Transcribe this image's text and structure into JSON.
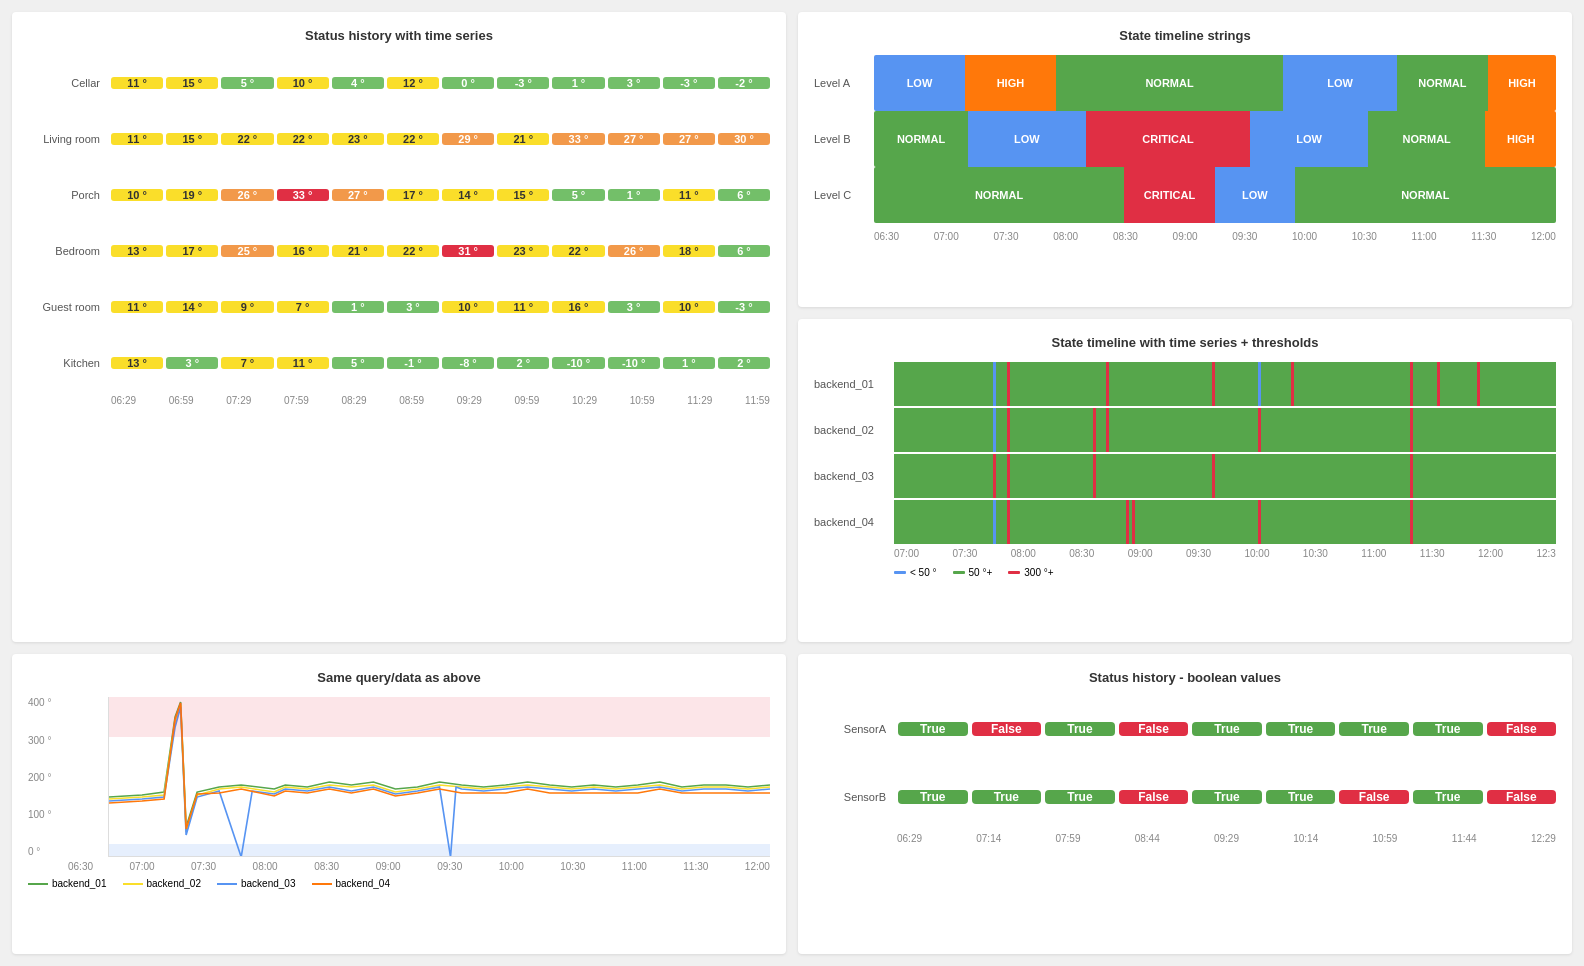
{
  "panels": {
    "state_timeline_strings": {
      "title": "State timeline strings",
      "rows": [
        {
          "label": "Level A",
          "segments": [
            {
              "type": "low",
              "label": "LOW",
              "flex": 8
            },
            {
              "type": "high",
              "label": "HIGH",
              "flex": 8
            },
            {
              "type": "normal",
              "label": "NORMAL",
              "flex": 20
            },
            {
              "type": "low",
              "label": "LOW",
              "flex": 10
            },
            {
              "type": "normal",
              "label": "NORMAL",
              "flex": 8
            },
            {
              "type": "high",
              "label": "HIGH",
              "flex": 6
            }
          ]
        },
        {
          "label": "Level B",
          "segments": [
            {
              "type": "normal",
              "label": "NORMAL",
              "flex": 8
            },
            {
              "type": "low",
              "label": "LOW",
              "flex": 10
            },
            {
              "type": "critical",
              "label": "CRITICAL",
              "flex": 14
            },
            {
              "type": "low",
              "label": "LOW",
              "flex": 10
            },
            {
              "type": "normal",
              "label": "NORMAL",
              "flex": 10
            },
            {
              "type": "high",
              "label": "HIGH",
              "flex": 6
            }
          ]
        },
        {
          "label": "Level C",
          "segments": [
            {
              "type": "normal",
              "label": "NORMAL",
              "flex": 22
            },
            {
              "type": "critical",
              "label": "CRITICAL",
              "flex": 8
            },
            {
              "type": "low",
              "label": "LOW",
              "flex": 7
            },
            {
              "type": "normal",
              "label": "NORMAL",
              "flex": 23
            }
          ]
        }
      ],
      "xaxis": [
        "06:30",
        "07:00",
        "07:30",
        "08:00",
        "08:30",
        "09:00",
        "09:30",
        "10:00",
        "10:30",
        "11:00",
        "11:30",
        "12:00"
      ]
    },
    "state_timeline_thresholds": {
      "title": "State timeline with time series + thresholds",
      "backends": [
        "backend_01",
        "backend_02",
        "backend_03",
        "backend_04"
      ],
      "xaxis": [
        "07:00",
        "07:30",
        "08:00",
        "08:30",
        "09:00",
        "09:30",
        "10:00",
        "10:30",
        "11:00",
        "11:30",
        "12:00",
        "12:3"
      ],
      "legend": [
        {
          "color": "#5794F2",
          "label": "< 50 °"
        },
        {
          "color": "#56A64B",
          "label": "50 °+"
        },
        {
          "color": "#E02F44",
          "label": "300 °+"
        }
      ],
      "thresholds": {
        "backend_01": [
          {
            "pos": 15,
            "type": "blue"
          },
          {
            "pos": 17,
            "type": "red"
          },
          {
            "pos": 32,
            "type": "red"
          },
          {
            "pos": 48,
            "type": "red"
          },
          {
            "pos": 55,
            "type": "blue"
          },
          {
            "pos": 60,
            "type": "red"
          },
          {
            "pos": 78,
            "type": "red"
          },
          {
            "pos": 82,
            "type": "red"
          },
          {
            "pos": 88,
            "type": "red"
          }
        ],
        "backend_02": [
          {
            "pos": 15,
            "type": "blue"
          },
          {
            "pos": 17,
            "type": "red"
          },
          {
            "pos": 30,
            "type": "red"
          },
          {
            "pos": 32,
            "type": "red"
          },
          {
            "pos": 55,
            "type": "red"
          },
          {
            "pos": 78,
            "type": "red"
          }
        ],
        "backend_03": [
          {
            "pos": 15,
            "type": "red"
          },
          {
            "pos": 17,
            "type": "red"
          },
          {
            "pos": 30,
            "type": "red"
          },
          {
            "pos": 48,
            "type": "red"
          },
          {
            "pos": 78,
            "type": "red"
          }
        ],
        "backend_04": [
          {
            "pos": 15,
            "type": "blue"
          },
          {
            "pos": 17,
            "type": "red"
          },
          {
            "pos": 35,
            "type": "red"
          },
          {
            "pos": 36,
            "type": "red"
          },
          {
            "pos": 55,
            "type": "red"
          },
          {
            "pos": 78,
            "type": "red"
          }
        ]
      }
    },
    "same_query": {
      "title": "Same query/data as above",
      "xaxis": [
        "06:30",
        "07:00",
        "07:30",
        "08:00",
        "08:30",
        "09:00",
        "09:30",
        "10:00",
        "10:30",
        "11:00",
        "11:30",
        "12:00"
      ],
      "yaxis": [
        "0 °",
        "100 °",
        "200 °",
        "300 °",
        "400 °"
      ],
      "legend": [
        {
          "color": "#56A64B",
          "label": "backend_01"
        },
        {
          "color": "#FADE2A",
          "label": "backend_02"
        },
        {
          "color": "#5794F2",
          "label": "backend_03"
        },
        {
          "color": "#FF780A",
          "label": "backend_04"
        }
      ]
    },
    "status_history": {
      "title": "Status history with time series",
      "rows": [
        {
          "label": "Cellar",
          "cells": [
            {
              "value": "11 °",
              "color": "yellow"
            },
            {
              "value": "15 °",
              "color": "yellow"
            },
            {
              "value": "5 °",
              "color": "green"
            },
            {
              "value": "10 °",
              "color": "yellow"
            },
            {
              "value": "4 °",
              "color": "green"
            },
            {
              "value": "12 °",
              "color": "yellow"
            },
            {
              "value": "0 °",
              "color": "green"
            },
            {
              "value": "-3 °",
              "color": "green"
            },
            {
              "value": "1 °",
              "color": "green"
            },
            {
              "value": "3 °",
              "color": "green"
            },
            {
              "value": "-3 °",
              "color": "green"
            },
            {
              "value": "-2 °",
              "color": "green"
            }
          ]
        },
        {
          "label": "Living room",
          "cells": [
            {
              "value": "11 °",
              "color": "yellow"
            },
            {
              "value": "15 °",
              "color": "yellow"
            },
            {
              "value": "22 °",
              "color": "yellow"
            },
            {
              "value": "22 °",
              "color": "yellow"
            },
            {
              "value": "23 °",
              "color": "yellow"
            },
            {
              "value": "22 °",
              "color": "yellow"
            },
            {
              "value": "29 °",
              "color": "orange"
            },
            {
              "value": "21 °",
              "color": "yellow"
            },
            {
              "value": "33 °",
              "color": "orange"
            },
            {
              "value": "27 °",
              "color": "orange"
            },
            {
              "value": "27 °",
              "color": "orange"
            },
            {
              "value": "30 °",
              "color": "orange"
            }
          ]
        },
        {
          "label": "Porch",
          "cells": [
            {
              "value": "10 °",
              "color": "yellow"
            },
            {
              "value": "19 °",
              "color": "yellow"
            },
            {
              "value": "26 °",
              "color": "orange"
            },
            {
              "value": "33 °",
              "color": "red"
            },
            {
              "value": "27 °",
              "color": "orange"
            },
            {
              "value": "17 °",
              "color": "yellow"
            },
            {
              "value": "14 °",
              "color": "yellow"
            },
            {
              "value": "15 °",
              "color": "yellow"
            },
            {
              "value": "5 °",
              "color": "green"
            },
            {
              "value": "1 °",
              "color": "green"
            },
            {
              "value": "11 °",
              "color": "yellow"
            },
            {
              "value": "6 °",
              "color": "green"
            }
          ]
        },
        {
          "label": "Bedroom",
          "cells": [
            {
              "value": "13 °",
              "color": "yellow"
            },
            {
              "value": "17 °",
              "color": "yellow"
            },
            {
              "value": "25 °",
              "color": "orange"
            },
            {
              "value": "16 °",
              "color": "yellow"
            },
            {
              "value": "21 °",
              "color": "yellow"
            },
            {
              "value": "22 °",
              "color": "yellow"
            },
            {
              "value": "31 °",
              "color": "red"
            },
            {
              "value": "23 °",
              "color": "yellow"
            },
            {
              "value": "22 °",
              "color": "yellow"
            },
            {
              "value": "26 °",
              "color": "orange"
            },
            {
              "value": "18 °",
              "color": "yellow"
            },
            {
              "value": "6 °",
              "color": "green"
            }
          ]
        },
        {
          "label": "Guest room",
          "cells": [
            {
              "value": "11 °",
              "color": "yellow"
            },
            {
              "value": "14 °",
              "color": "yellow"
            },
            {
              "value": "9 °",
              "color": "yellow"
            },
            {
              "value": "7 °",
              "color": "yellow"
            },
            {
              "value": "1 °",
              "color": "green"
            },
            {
              "value": "3 °",
              "color": "green"
            },
            {
              "value": "10 °",
              "color": "yellow"
            },
            {
              "value": "11 °",
              "color": "yellow"
            },
            {
              "value": "16 °",
              "color": "yellow"
            },
            {
              "value": "3 °",
              "color": "green"
            },
            {
              "value": "10 °",
              "color": "yellow"
            },
            {
              "value": "-3 °",
              "color": "green"
            }
          ]
        },
        {
          "label": "Kitchen",
          "cells": [
            {
              "value": "13 °",
              "color": "yellow"
            },
            {
              "value": "3 °",
              "color": "green"
            },
            {
              "value": "7 °",
              "color": "yellow"
            },
            {
              "value": "11 °",
              "color": "yellow"
            },
            {
              "value": "5 °",
              "color": "green"
            },
            {
              "value": "-1 °",
              "color": "green"
            },
            {
              "value": "-8 °",
              "color": "green"
            },
            {
              "value": "2 °",
              "color": "green"
            },
            {
              "value": "-10 °",
              "color": "green"
            },
            {
              "value": "-10 °",
              "color": "green"
            },
            {
              "value": "1 °",
              "color": "green"
            },
            {
              "value": "2 °",
              "color": "green"
            }
          ]
        }
      ],
      "xaxis": [
        "06:29",
        "06:59",
        "07:29",
        "07:59",
        "08:29",
        "08:59",
        "09:29",
        "09:59",
        "10:29",
        "10:59",
        "11:29",
        "11:59"
      ]
    },
    "status_history_boolean": {
      "title": "Status history - boolean values",
      "rows": [
        {
          "label": "SensorA",
          "cells": [
            {
              "value": "True",
              "bool": true
            },
            {
              "value": "False",
              "bool": false
            },
            {
              "value": "True",
              "bool": true
            },
            {
              "value": "False",
              "bool": false
            },
            {
              "value": "True",
              "bool": true
            },
            {
              "value": "True",
              "bool": true
            },
            {
              "value": "True",
              "bool": true
            },
            {
              "value": "True",
              "bool": true
            },
            {
              "value": "False",
              "bool": false
            }
          ]
        },
        {
          "label": "SensorB",
          "cells": [
            {
              "value": "True",
              "bool": true
            },
            {
              "value": "True",
              "bool": true
            },
            {
              "value": "True",
              "bool": true
            },
            {
              "value": "False",
              "bool": false
            },
            {
              "value": "True",
              "bool": true
            },
            {
              "value": "True",
              "bool": true
            },
            {
              "value": "False",
              "bool": false
            },
            {
              "value": "True",
              "bool": true
            },
            {
              "value": "False",
              "bool": false
            }
          ]
        }
      ],
      "xaxis": [
        "06:29",
        "07:14",
        "07:59",
        "08:44",
        "09:29",
        "10:14",
        "10:59",
        "11:44",
        "12:29"
      ]
    }
  }
}
